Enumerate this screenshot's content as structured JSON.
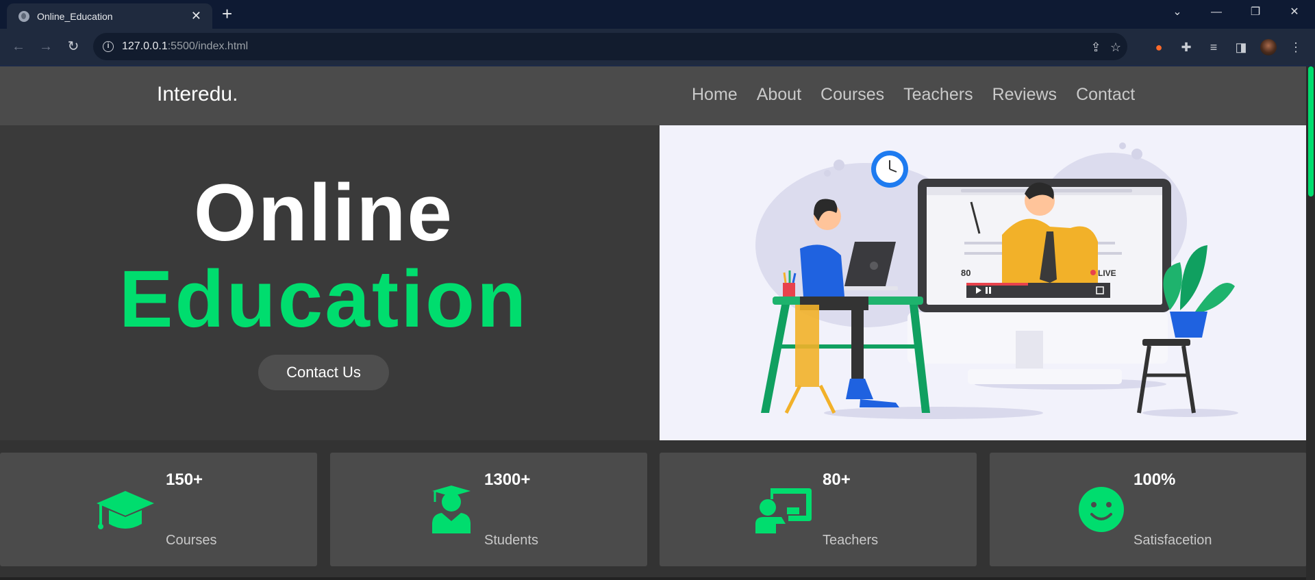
{
  "browser": {
    "tab_title": "Online_Education",
    "tab_close": "✕",
    "new_tab": "+",
    "url_host": "127.0.0.1",
    "url_rest": ":5500/index.html",
    "window_controls": {
      "tab_search": "⌄",
      "minimize": "—",
      "restore": "❐",
      "close": "✕"
    }
  },
  "site": {
    "logo": "Interedu.",
    "nav": [
      "Home",
      "About",
      "Courses",
      "Teachers",
      "Reviews",
      "Contact"
    ],
    "hero": {
      "line1": "Online",
      "line2": "Education",
      "cta": "Contact Us",
      "illustration": {
        "viewers": "80",
        "live": "LIVE"
      }
    },
    "stats": [
      {
        "number": "150+",
        "label": "Courses",
        "icon": "graduation-cap-icon"
      },
      {
        "number": "1300+",
        "label": "Students",
        "icon": "user-graduate-icon"
      },
      {
        "number": "80+",
        "label": "Teachers",
        "icon": "chalkboard-teacher-icon"
      },
      {
        "number": "100%",
        "label": "Satisfacetion",
        "icon": "smile-icon"
      }
    ]
  },
  "colors": {
    "accent": "#00dd6e",
    "page_bg": "#333333",
    "card_bg": "#4b4b4b"
  }
}
